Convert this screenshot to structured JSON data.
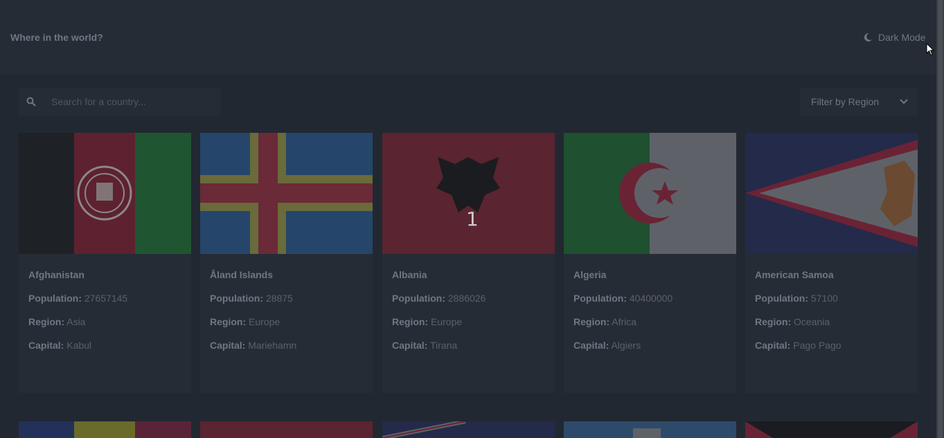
{
  "header": {
    "title": "Where in the world?",
    "dark_mode_label": "Dark Mode"
  },
  "search": {
    "placeholder": "Search for a country..."
  },
  "filter": {
    "label": "Filter by Region"
  },
  "labels": {
    "population": "Population:",
    "region": "Region:",
    "capital": "Capital:"
  },
  "countries": [
    {
      "name": "Afghanistan",
      "population": "27657145",
      "region": "Asia",
      "capital": "Kabul"
    },
    {
      "name": "Åland Islands",
      "population": "28875",
      "region": "Europe",
      "capital": "Mariehamn"
    },
    {
      "name": "Albania",
      "population": "2886026",
      "region": "Europe",
      "capital": "Tirana"
    },
    {
      "name": "Algeria",
      "population": "40400000",
      "region": "Africa",
      "capital": "Algiers"
    },
    {
      "name": "American Samoa",
      "population": "57100",
      "region": "Oceania",
      "capital": "Pago Pago"
    }
  ],
  "overlay_badge": "1",
  "colors": {
    "background": "#222831",
    "surface": "#262c36",
    "text": "#6f7782"
  }
}
